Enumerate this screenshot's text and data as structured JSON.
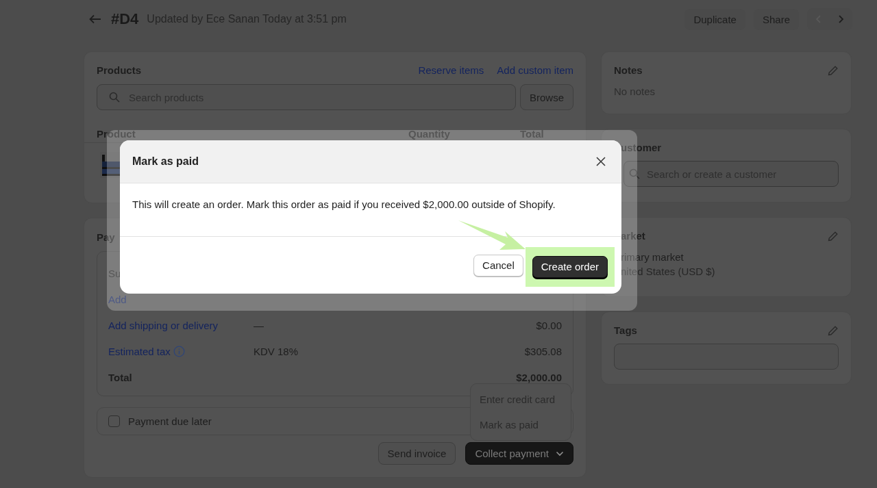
{
  "header": {
    "title": "#D4",
    "subtitle": "Updated by Ece Sanan Today at 3:51 pm",
    "actions": [
      {
        "label": "Duplicate"
      },
      {
        "label": "Share"
      }
    ],
    "pager": {
      "prev_disabled": true,
      "next_disabled": false
    }
  },
  "products": {
    "title": "Products",
    "links": [
      "Reserve items",
      "Add custom item"
    ],
    "search": {
      "placeholder": "Search products"
    },
    "browse": "Browse",
    "columns": [
      "Product",
      "Quantity",
      "Total"
    ]
  },
  "payment": {
    "title": "Pay",
    "summary": [
      {
        "kind": "text",
        "label": "Su"
      },
      {
        "kind": "link",
        "label": "Add"
      },
      {
        "kind": "link",
        "label": "Add shipping or delivery",
        "detail": "—",
        "amount": "$0.00"
      },
      {
        "kind": "link",
        "label": "Estimated tax",
        "info": true,
        "detail": "KDV 18%",
        "amount": "$305.08"
      },
      {
        "kind": "total",
        "label": "Total",
        "amount": "$2,000.00"
      }
    ],
    "due_later": {
      "label": "Payment due later",
      "checked": false
    },
    "buttons": [
      {
        "kind": "secondary",
        "label": "Send invoice"
      },
      {
        "kind": "primary",
        "label": "Collect payment"
      }
    ],
    "menu": [
      {
        "label": "Enter credit card"
      },
      {
        "label": "Mark as paid"
      }
    ]
  },
  "sidebar": {
    "notes": {
      "title": "Notes",
      "text": "No notes"
    },
    "customer": {
      "title": "ustomer",
      "search": {
        "placeholder": "Search or create a customer"
      }
    },
    "market": {
      "title": "arket",
      "lines": [
        "rimary market",
        "nited States (USD $)"
      ]
    },
    "tags": {
      "title": "Tags"
    }
  },
  "modal": {
    "title": "Mark as paid",
    "body": "This will create an order. Mark this order as paid if you received $2,000.00 outside of Shopify.",
    "buttons": [
      {
        "kind": "secondary",
        "label": "Cancel",
        "highlighted": false
      },
      {
        "kind": "primary",
        "label": "Create order",
        "highlighted": true
      }
    ]
  }
}
